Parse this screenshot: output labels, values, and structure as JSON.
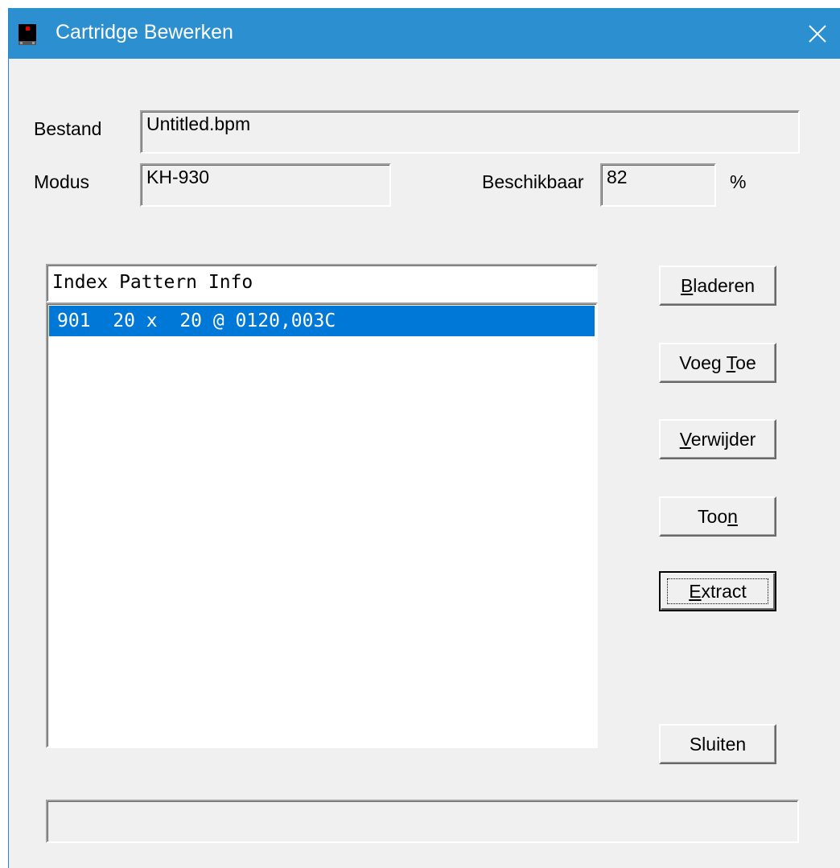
{
  "window": {
    "title": "Cartridge Bewerken",
    "title_bar_color": "#2b8fd0",
    "icons": {
      "app": "cartridge-app-icon",
      "close": "close-icon"
    }
  },
  "fields": {
    "bestand_label": "Bestand",
    "bestand_value": "Untitled.bpm",
    "modus_label": "Modus",
    "modus_value": "KH-930",
    "beschikbaar_label": "Beschikbaar",
    "beschikbaar_value": "82",
    "percent_sign": "%"
  },
  "list": {
    "header": "Index Pattern Info",
    "rows": [
      {
        "text": "901  20 x  20 @ 0120,003C",
        "selected": true
      }
    ],
    "selection_color": "#0078d7"
  },
  "buttons": {
    "bladeren": {
      "mnemonic": "B",
      "rest": "laderen"
    },
    "voeg_toe": {
      "pre": "Voeg ",
      "mnemonic": "T",
      "rest": "oe"
    },
    "verwijder": {
      "mnemonic": "V",
      "rest": "erwijder"
    },
    "toon": {
      "pre": "Too",
      "mnemonic": "n",
      "rest": ""
    },
    "extract": {
      "mnemonic": "E",
      "rest": "xtract"
    },
    "sluiten": "Sluiten"
  },
  "status": {
    "text": ""
  }
}
